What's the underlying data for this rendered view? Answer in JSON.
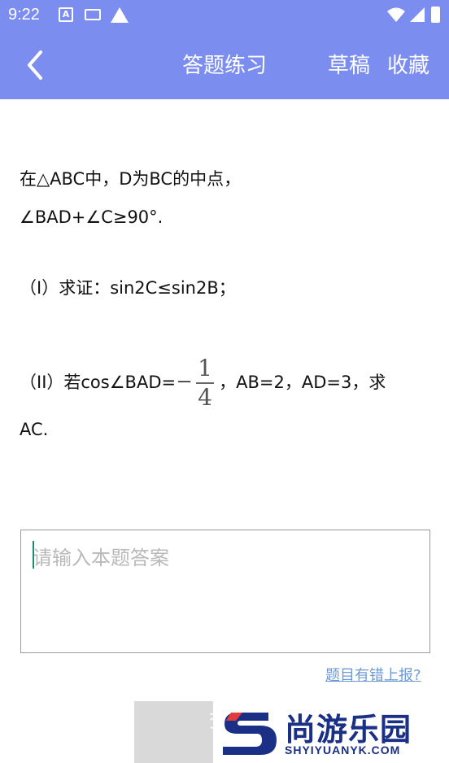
{
  "status_bar": {
    "time": "9:22",
    "icons": [
      "a-notification-icon",
      "keyboard-icon",
      "warning-icon",
      "wifi-icon",
      "signal-icon",
      "battery-icon"
    ]
  },
  "header": {
    "title": "答题练习",
    "draft_label": "草稿",
    "favorite_label": "收藏",
    "background": "#7b8ef0"
  },
  "question": {
    "line1": "在△ABC中，D为BC的中点，",
    "line2": "∠BAD+∠C≥90°.",
    "part1": "（I）求证：sin2C≤sin2B；",
    "part2_before": "（II）若cos∠BAD=－",
    "fraction_numerator": "1",
    "fraction_denominator": "4",
    "part2_after": "，AB=2，AD=3，求",
    "part2_end": "AC."
  },
  "answer": {
    "placeholder": "请输入本题答案",
    "value": ""
  },
  "report_link": "题目有错上报?",
  "buttons": {
    "view_label": "查看"
  },
  "watermark": {
    "cn": "尚游乐园",
    "en": "SHYIYUANYK.COM",
    "color": "#1a2f86"
  }
}
